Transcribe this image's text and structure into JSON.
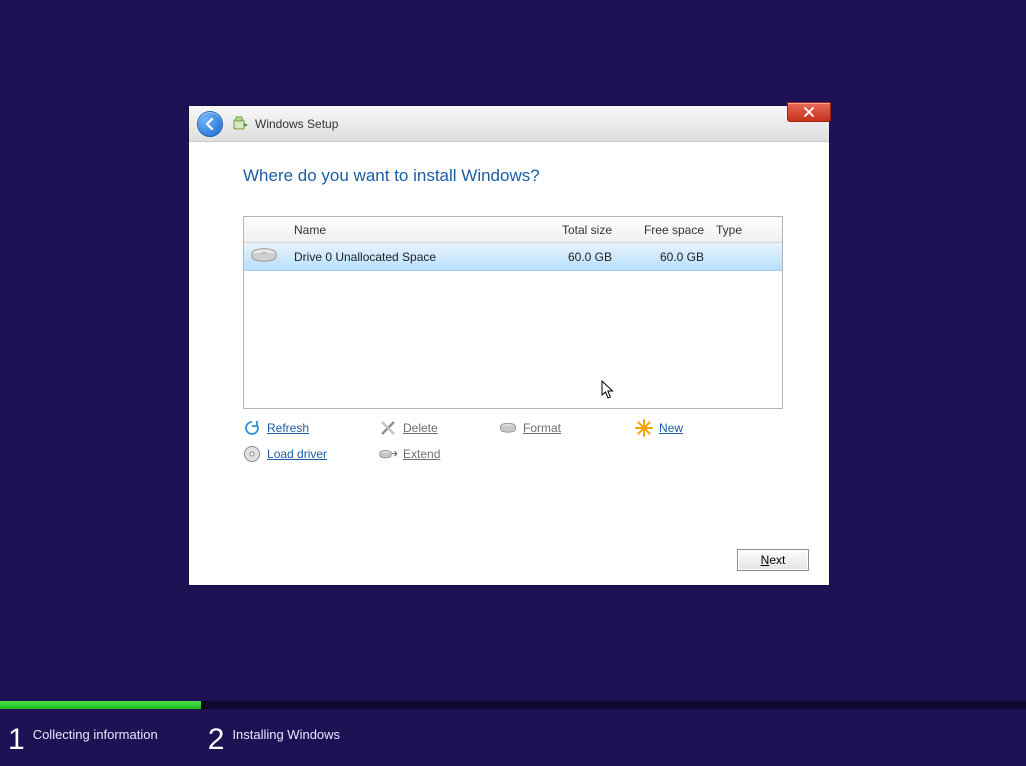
{
  "window": {
    "title": "Windows Setup",
    "close_label": "Close"
  },
  "heading": "Where do you want to install Windows?",
  "table": {
    "headers": {
      "name": "Name",
      "total_size": "Total size",
      "free_space": "Free space",
      "type": "Type"
    },
    "rows": [
      {
        "name": "Drive 0 Unallocated Space",
        "total_size": "60.0 GB",
        "free_space": "60.0 GB",
        "type": ""
      }
    ]
  },
  "actions": {
    "refresh": "Refresh",
    "delete": "Delete",
    "format": "Format",
    "new": "New",
    "load_driver": "Load driver",
    "extend": "Extend"
  },
  "next_label": "Next",
  "steps": [
    {
      "num": "1",
      "label": "Collecting information"
    },
    {
      "num": "2",
      "label": "Installing Windows"
    }
  ]
}
